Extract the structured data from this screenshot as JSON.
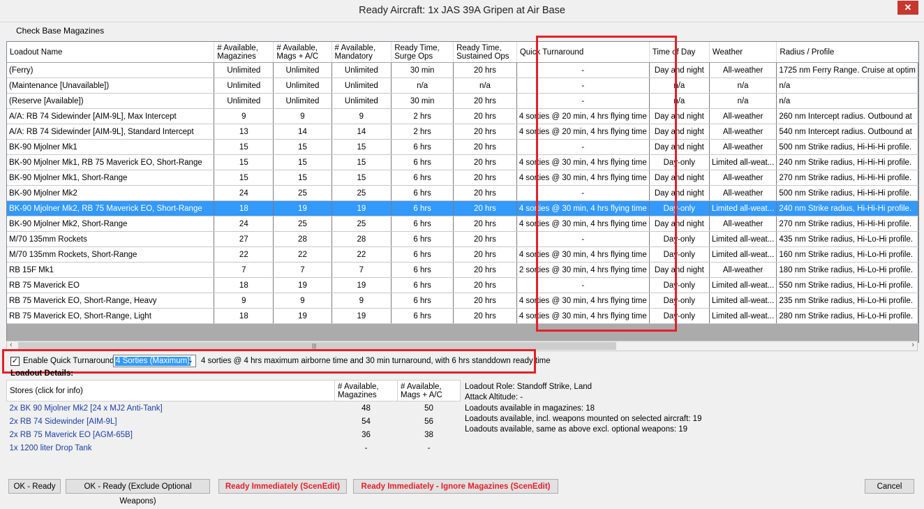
{
  "window": {
    "title": "Ready Aircraft: 1x JAS 39A Gripen at Air Base",
    "close_glyph": "✕"
  },
  "toolbar": {
    "check_magazines": "Check Base Magazines"
  },
  "table": {
    "columns": [
      "Loadout Name",
      "# Available, Magazines",
      "# Available, Mags + A/C",
      "# Available, Mandatory",
      "Ready Time, Surge Ops",
      "Ready Time, Sustained Ops",
      "Quick Turnaround",
      "Time of Day",
      "Weather",
      "Radius / Profile"
    ],
    "rows": [
      [
        "(Ferry)",
        "Unlimited",
        "Unlimited",
        "Unlimited",
        "30 min",
        "20 hrs",
        "-",
        "Day and night",
        "All-weather",
        "1725 nm Ferry Range. Cruise at optim"
      ],
      [
        "(Maintenance [Unavailable])",
        "Unlimited",
        "Unlimited",
        "Unlimited",
        "n/a",
        "n/a",
        "-",
        "n/a",
        "n/a",
        "n/a"
      ],
      [
        "(Reserve [Available])",
        "Unlimited",
        "Unlimited",
        "Unlimited",
        "30 min",
        "20 hrs",
        "-",
        "n/a",
        "n/a",
        "n/a"
      ],
      [
        "A/A: RB 74 Sidewinder [AIM-9L], Max Intercept",
        "9",
        "9",
        "9",
        "2 hrs",
        "20 hrs",
        "4 sorties @ 20 min, 4 hrs flying time",
        "Day and night",
        "All-weather",
        "260 nm Intercept radius. Outbound at"
      ],
      [
        "A/A: RB 74 Sidewinder [AIM-9L], Standard Intercept",
        "13",
        "14",
        "14",
        "2 hrs",
        "20 hrs",
        "4 sorties @ 20 min, 4 hrs flying time",
        "Day and night",
        "All-weather",
        "540 nm Intercept radius. Outbound at"
      ],
      [
        "BK-90 Mjolner Mk1",
        "15",
        "15",
        "15",
        "6 hrs",
        "20 hrs",
        "-",
        "Day and night",
        "All-weather",
        "500 nm Strike radius, Hi-Hi-Hi profile."
      ],
      [
        "BK-90 Mjolner Mk1, RB 75 Maverick EO, Short-Range",
        "15",
        "15",
        "15",
        "6 hrs",
        "20 hrs",
        "4 sorties @ 30 min, 4 hrs flying time",
        "Day-only",
        "Limited all-weat...",
        "240 nm Strike radius, Hi-Hi-Hi profile."
      ],
      [
        "BK-90 Mjolner Mk1, Short-Range",
        "15",
        "15",
        "15",
        "6 hrs",
        "20 hrs",
        "4 sorties @ 30 min, 4 hrs flying time",
        "Day and night",
        "All-weather",
        "270 nm Strike radius, Hi-Hi-Hi profile."
      ],
      [
        "BK-90 Mjolner Mk2",
        "24",
        "25",
        "25",
        "6 hrs",
        "20 hrs",
        "-",
        "Day and night",
        "All-weather",
        "500 nm Strike radius, Hi-Hi-Hi profile."
      ],
      [
        "BK-90 Mjolner Mk2, RB 75 Maverick EO, Short-Range",
        "18",
        "19",
        "19",
        "6 hrs",
        "20 hrs",
        "4 sorties @ 30 min, 4 hrs flying time",
        "Day-only",
        "Limited all-weat...",
        "240 nm Strike radius, Hi-Hi-Hi profile."
      ],
      [
        "BK-90 Mjolner Mk2, Short-Range",
        "24",
        "25",
        "25",
        "6 hrs",
        "20 hrs",
        "4 sorties @ 30 min, 4 hrs flying time",
        "Day and night",
        "All-weather",
        "270 nm Strike radius, Hi-Hi-Hi profile."
      ],
      [
        "M/70 135mm Rockets",
        "27",
        "28",
        "28",
        "6 hrs",
        "20 hrs",
        "-",
        "Day-only",
        "Limited all-weat...",
        "435 nm Strike radius, Hi-Lo-Hi profile."
      ],
      [
        "M/70 135mm Rockets, Short-Range",
        "22",
        "22",
        "22",
        "6 hrs",
        "20 hrs",
        "4 sorties @ 30 min, 4 hrs flying time",
        "Day-only",
        "Limited all-weat...",
        "160 nm Strike radius, Hi-Lo-Hi profile."
      ],
      [
        "RB 15F Mk1",
        "7",
        "7",
        "7",
        "6 hrs",
        "20 hrs",
        "2 sorties @ 30 min, 4 hrs flying time",
        "Day and night",
        "All-weather",
        "180 nm Strike radius, Hi-Lo-Hi profile."
      ],
      [
        "RB 75 Maverick EO",
        "18",
        "19",
        "19",
        "6 hrs",
        "20 hrs",
        "-",
        "Day-only",
        "Limited all-weat...",
        "550 nm Strike radius, Hi-Lo-Hi profile."
      ],
      [
        "RB 75 Maverick EO, Short-Range, Heavy",
        "9",
        "9",
        "9",
        "6 hrs",
        "20 hrs",
        "4 sorties @ 30 min, 4 hrs flying time",
        "Day-only",
        "Limited all-weat...",
        "235 nm Strike radius, Hi-Lo-Hi profile."
      ],
      [
        "RB 75 Maverick EO, Short-Range, Light",
        "18",
        "19",
        "19",
        "6 hrs",
        "20 hrs",
        "4 sorties @ 30 min, 4 hrs flying time",
        "Day-only",
        "Limited all-weat...",
        "280 nm Strike radius, Hi-Lo-Hi profile."
      ]
    ],
    "selected_row": 9
  },
  "quick_turnaround": {
    "checkbox_label": "Enable Quick Turnaround",
    "checked": true,
    "check_glyph": "✓",
    "selected_option": "4 Sorties (Maximum)",
    "description": "4 sorties @ 4 hrs maximum airborne time and 30 min turnaround, with 6 hrs standdown ready time"
  },
  "loadout_details": {
    "label": "Loadout Details:",
    "columns": [
      "Stores (click for info)",
      "# Available, Magazines",
      "# Available, Mags + A/C"
    ],
    "rows": [
      [
        "2x BK 90 Mjolner Mk2 [24 x MJ2 Anti-Tank]",
        "48",
        "50"
      ],
      [
        "2x RB 74 Sidewinder [AIM-9L]",
        "54",
        "56"
      ],
      [
        "2x RB 75 Maverick EO [AGM-65B]",
        "36",
        "38"
      ],
      [
        "1x 1200 liter Drop Tank",
        "-",
        "-"
      ]
    ],
    "info": [
      "Loadout Role: Standoff Strike, Land",
      "Attack Altitude: -",
      "Loadouts available in magazines: 18",
      "Loadouts available, incl. weapons mounted on selected aircraft: 19",
      "Loadouts available, same as above excl. optional weapons: 19"
    ]
  },
  "buttons": {
    "ok_ready": "OK - Ready",
    "ok_ready_excl": "OK - Ready (Exclude Optional Weapons)",
    "ready_immediately": "Ready Immediately (ScenEdit)",
    "ready_ignore": "Ready Immediately - Ignore Magazines (ScenEdit)",
    "cancel": "Cancel"
  },
  "colors": {
    "selection": "#3399ff",
    "highlight_box": "#e3202a",
    "link": "#1a3fa8",
    "close_button": "#c7372f"
  }
}
